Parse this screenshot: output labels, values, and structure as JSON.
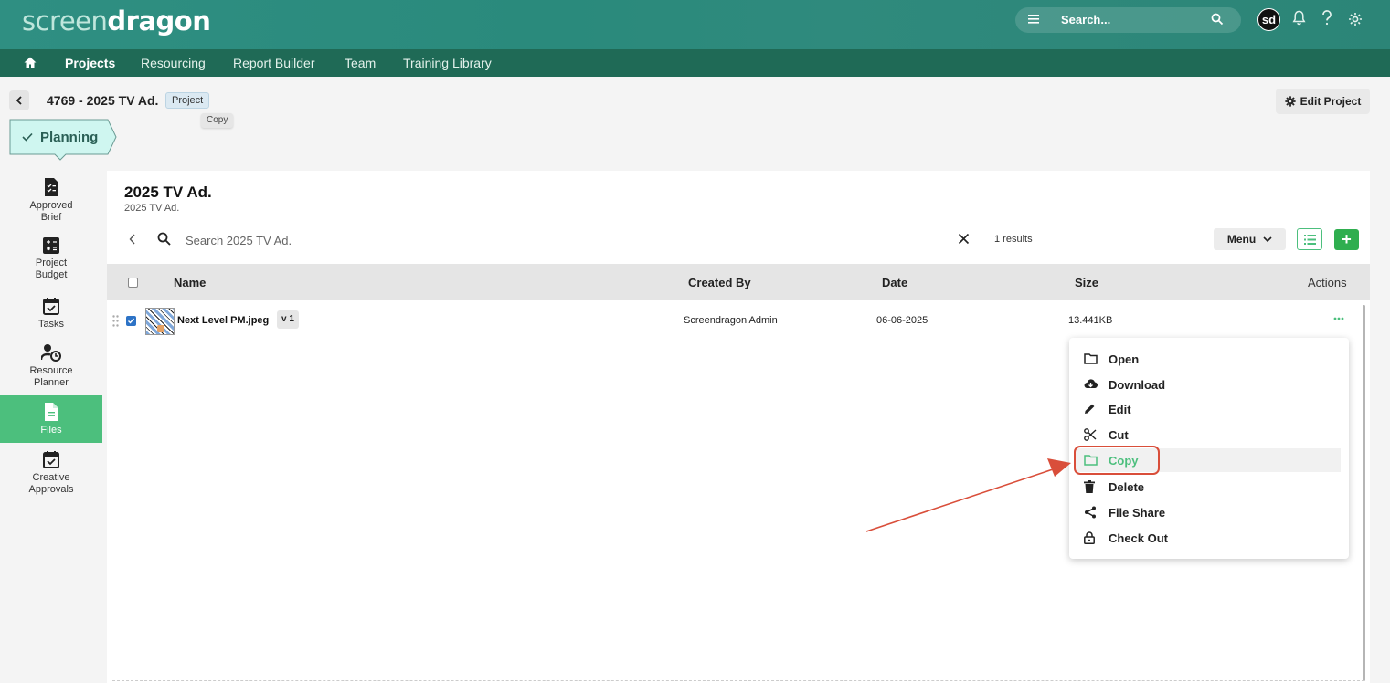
{
  "header": {
    "logo_part1": "screen",
    "logo_part2": "dragon",
    "search_placeholder": "Search...",
    "avatar_initials": "sd"
  },
  "nav": {
    "items": [
      {
        "label": "Projects",
        "active": true
      },
      {
        "label": "Resourcing"
      },
      {
        "label": "Report Builder"
      },
      {
        "label": "Team"
      },
      {
        "label": "Training Library"
      }
    ]
  },
  "project": {
    "title": "4769 - 2025 TV Ad.",
    "badge": "Project",
    "tooltip": "Copy",
    "edit_label": "Edit Project",
    "stage": "Planning"
  },
  "rail": {
    "items": [
      {
        "label_l1": "Approved",
        "label_l2": "Brief",
        "icon": "approved-brief-icon"
      },
      {
        "label_l1": "Project",
        "label_l2": "Budget",
        "icon": "budget-calculator-icon"
      },
      {
        "label_l1": "Tasks",
        "label_l2": "",
        "icon": "tasks-calendar-icon"
      },
      {
        "label_l1": "Resource",
        "label_l2": "Planner",
        "icon": "resource-planner-icon"
      },
      {
        "label_l1": "Files",
        "label_l2": "",
        "icon": "file-icon",
        "active": true
      },
      {
        "label_l1": "Creative",
        "label_l2": "Approvals",
        "icon": "approvals-calendar-icon"
      }
    ]
  },
  "panel": {
    "title": "2025 TV Ad.",
    "subtitle": "2025 TV Ad.",
    "search_placeholder": "Search 2025 TV Ad.",
    "results": "1 results",
    "menu_label": "Menu",
    "add_label": "+"
  },
  "table": {
    "columns": {
      "name": "Name",
      "created_by": "Created By",
      "date": "Date",
      "size": "Size",
      "actions": "Actions"
    },
    "rows": [
      {
        "name": "Next Level PM.jpeg",
        "version": "v 1",
        "created_by": "Screendragon Admin",
        "date": "06-06-2025",
        "size": "13.441KB",
        "checked": true
      }
    ]
  },
  "context_menu": {
    "items": [
      {
        "label": "Open",
        "icon": "folder-icon"
      },
      {
        "label": "Download",
        "icon": "cloud-download-icon"
      },
      {
        "label": "Edit",
        "icon": "pencil-icon"
      },
      {
        "label": "Cut",
        "icon": "scissors-icon"
      },
      {
        "label": "Copy",
        "icon": "folder-copy-icon",
        "highlighted": true
      },
      {
        "label": "Delete",
        "icon": "trash-icon"
      },
      {
        "label": "File Share",
        "icon": "share-icon"
      },
      {
        "label": "Check Out",
        "icon": "lock-icon"
      }
    ]
  },
  "colors": {
    "header": "#2a8a7c",
    "navbar": "#1f6a56",
    "accent_green": "#4cbf7d",
    "annotation_red": "#d94e3a"
  }
}
